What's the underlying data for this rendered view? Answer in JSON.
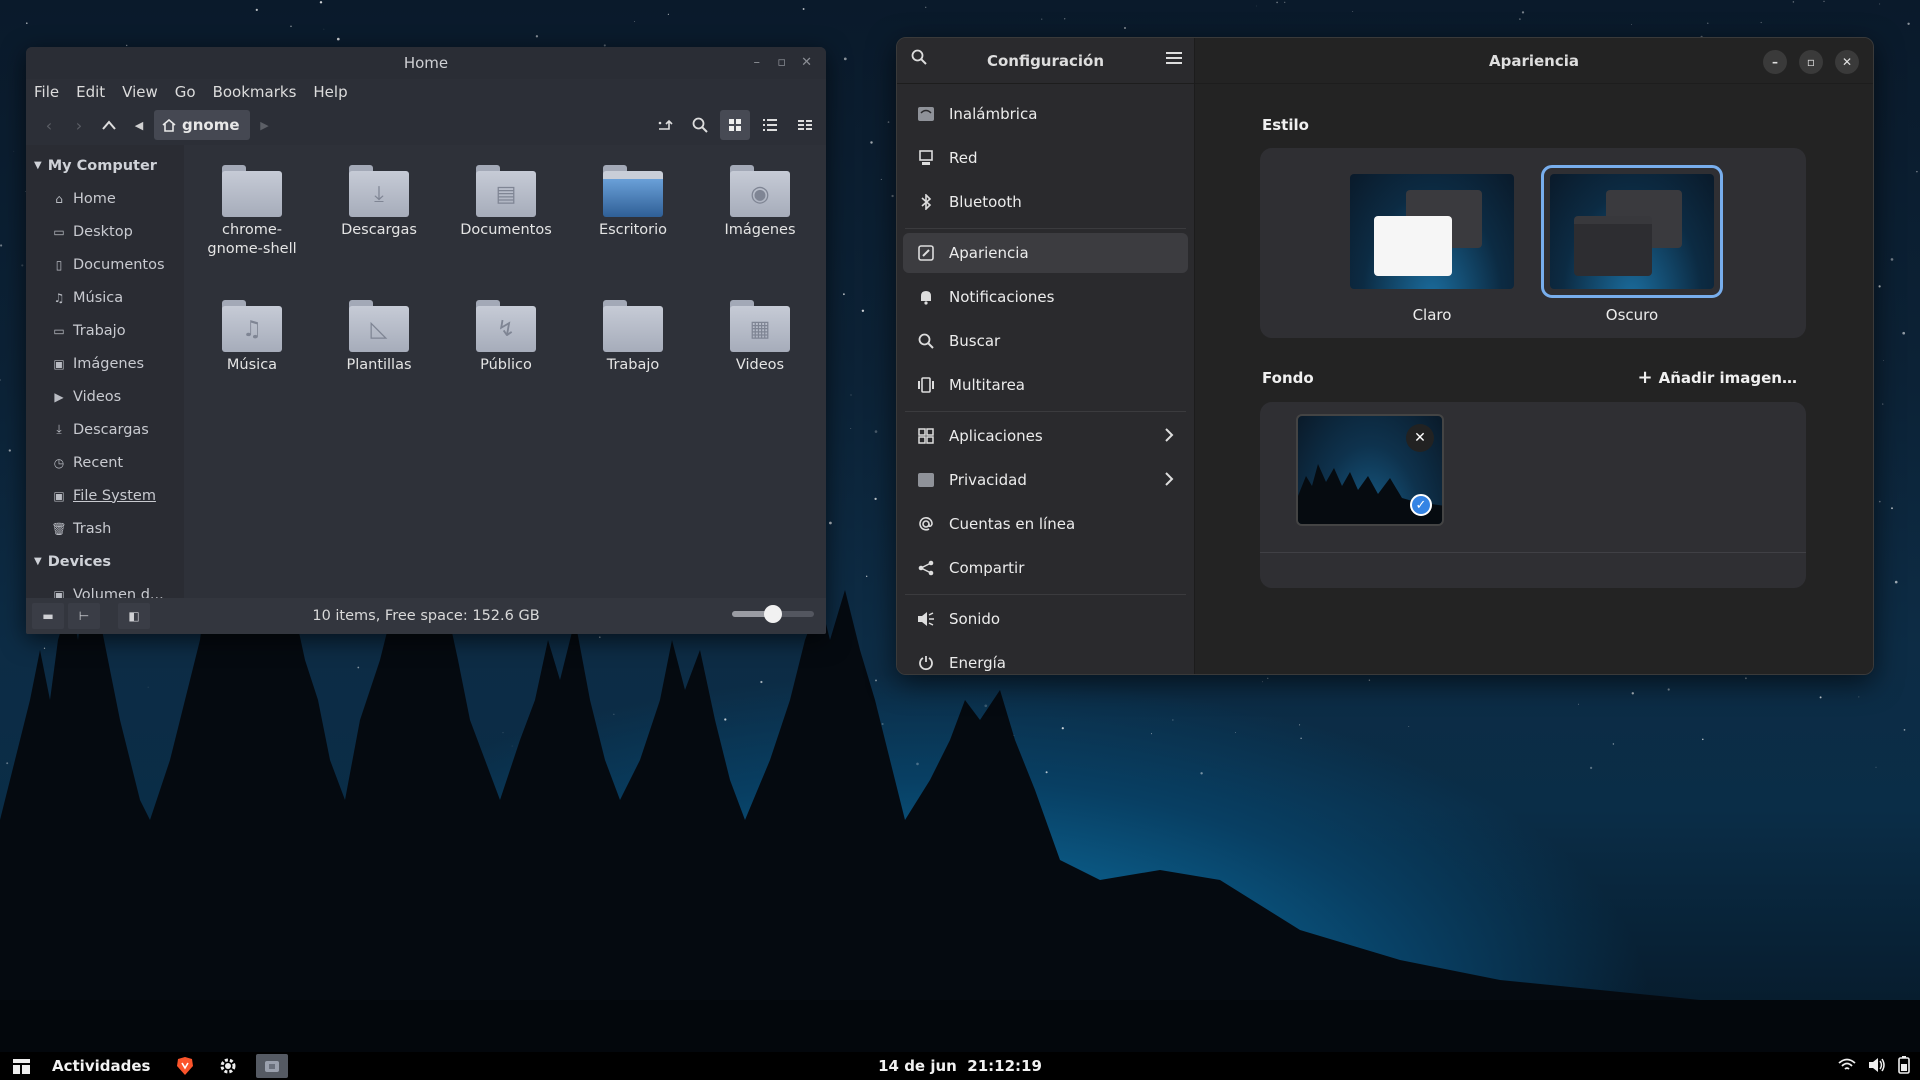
{
  "desktop": {
    "wallpaper": "night-forest"
  },
  "file_manager": {
    "title": "Home",
    "menu": [
      "File",
      "Edit",
      "View",
      "Go",
      "Bookmarks",
      "Help"
    ],
    "path": "gnome",
    "sidebar": {
      "my_computer": "My Computer",
      "places": [
        {
          "label": "Home",
          "icon": "home-icon"
        },
        {
          "label": "Desktop",
          "icon": "folder-icon"
        },
        {
          "label": "Documentos",
          "icon": "document-icon"
        },
        {
          "label": "Música",
          "icon": "music-icon"
        },
        {
          "label": "Trabajo",
          "icon": "folder-icon"
        },
        {
          "label": "Imágenes",
          "icon": "image-icon"
        },
        {
          "label": "Videos",
          "icon": "video-icon"
        },
        {
          "label": "Descargas",
          "icon": "download-icon"
        },
        {
          "label": "Recent",
          "icon": "clock-icon"
        },
        {
          "label": "File System",
          "icon": "drive-icon"
        },
        {
          "label": "Trash",
          "icon": "trash-icon"
        }
      ],
      "devices": "Devices",
      "device_items": [
        {
          "label": "Volumen d...",
          "icon": "drive-icon"
        }
      ]
    },
    "files": [
      {
        "label": "chrome-gnome-shell",
        "icon": "folder-icon"
      },
      {
        "label": "Descargas",
        "icon": "download-folder-icon"
      },
      {
        "label": "Documentos",
        "icon": "document-folder-icon"
      },
      {
        "label": "Escritorio",
        "icon": "desktop-folder-icon"
      },
      {
        "label": "Imágenes",
        "icon": "camera-folder-icon"
      },
      {
        "label": "Música",
        "icon": "music-folder-icon"
      },
      {
        "label": "Plantillas",
        "icon": "template-folder-icon"
      },
      {
        "label": "Público",
        "icon": "share-folder-icon"
      },
      {
        "label": "Trabajo",
        "icon": "folder-icon"
      },
      {
        "label": "Videos",
        "icon": "video-folder-icon"
      }
    ],
    "status": "10 items, Free space: 152.6 GB",
    "zoom_level": 0.5
  },
  "settings": {
    "sidebar_title": "Configuración",
    "nav_groups": [
      [
        {
          "label": "Inalámbrica",
          "icon": "wifi-icon"
        },
        {
          "label": "Red",
          "icon": "network-icon"
        },
        {
          "label": "Bluetooth",
          "icon": "bluetooth-icon"
        }
      ],
      [
        {
          "label": "Apariencia",
          "icon": "appearance-icon",
          "selected": true
        },
        {
          "label": "Notificaciones",
          "icon": "bell-icon"
        },
        {
          "label": "Buscar",
          "icon": "search-icon"
        },
        {
          "label": "Multitarea",
          "icon": "multitask-icon"
        }
      ],
      [
        {
          "label": "Aplicaciones",
          "icon": "apps-icon",
          "chevron": true
        },
        {
          "label": "Privacidad",
          "icon": "privacy-icon",
          "chevron": true
        },
        {
          "label": "Cuentas en línea",
          "icon": "at-icon"
        },
        {
          "label": "Compartir",
          "icon": "share-icon"
        }
      ],
      [
        {
          "label": "Sonido",
          "icon": "speaker-icon"
        },
        {
          "label": "Energía",
          "icon": "power-icon"
        }
      ]
    ],
    "panel_title": "Apariencia",
    "style_title": "Estilo",
    "style_options": [
      {
        "label": "Claro",
        "selected": false
      },
      {
        "label": "Oscuro",
        "selected": true
      }
    ],
    "background_title": "Fondo",
    "add_image": "Añadir imagen…",
    "accent": "#78aeed"
  },
  "taskbar": {
    "activities": "Actividades",
    "date": "14 de jun",
    "time": "21:12:19"
  }
}
